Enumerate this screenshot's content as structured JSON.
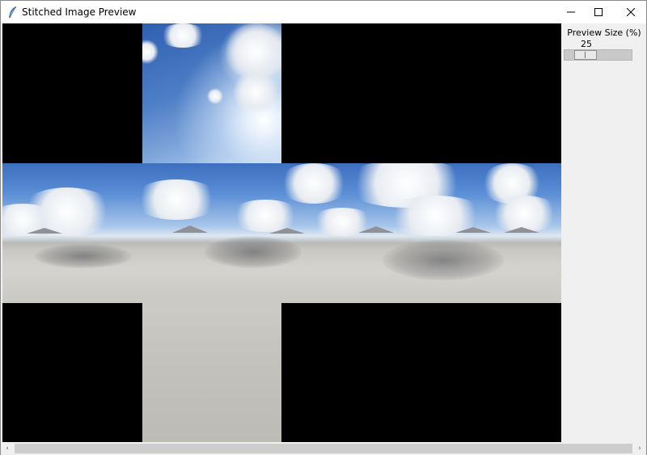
{
  "window": {
    "title": "Stitched Image Preview",
    "icons": {
      "app": "feather-icon",
      "minimize": "minimize-icon",
      "maximize": "maximize-icon",
      "close": "close-icon"
    }
  },
  "panel": {
    "label": "Preview Size (%)",
    "value": "25",
    "slider_value_percent": 25
  },
  "scrollbar": {
    "left_arrow": "‹",
    "right_arrow": "›"
  },
  "colors": {
    "canvas_background": "#000000",
    "panel_background": "#f0f0f0",
    "sky": "#4f7fc6",
    "ground": "#cbc9c4"
  }
}
